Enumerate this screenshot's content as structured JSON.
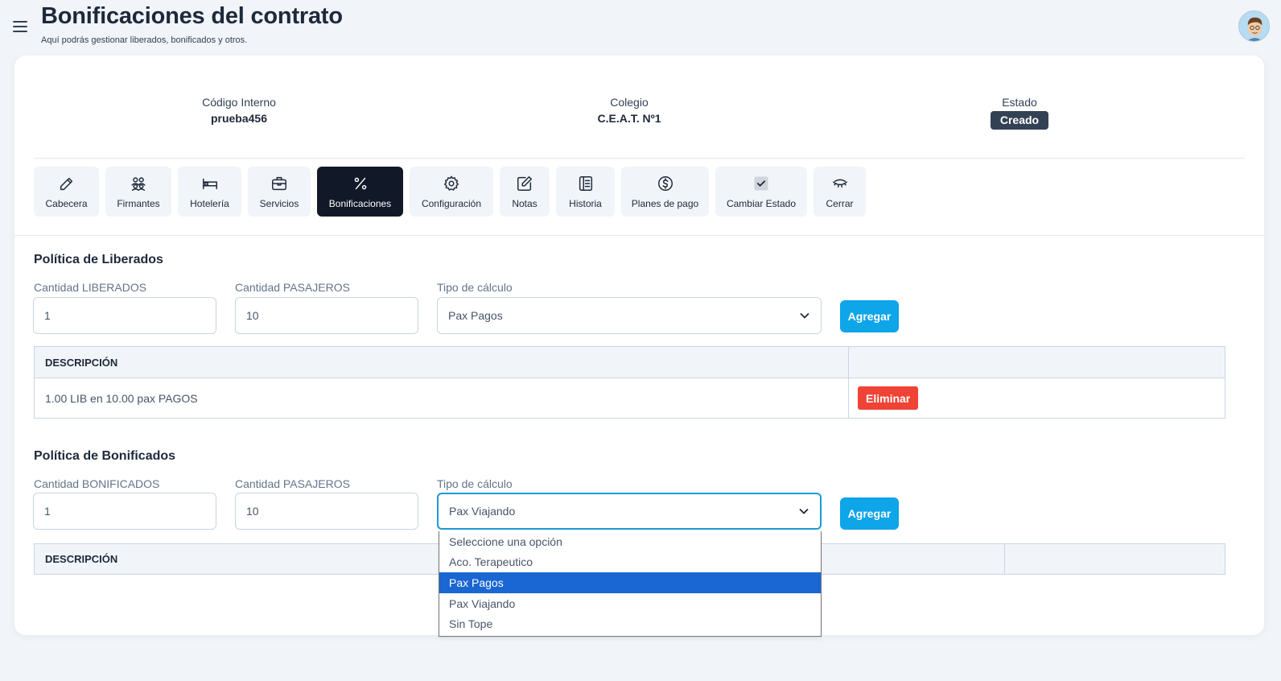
{
  "header": {
    "title": "Bonificaciones del contrato",
    "subtitle": "Aquí podrás gestionar liberados, bonificados y otros."
  },
  "info": {
    "codigo_label": "Código Interno",
    "codigo_value": "prueba456",
    "colegio_label": "Colegio",
    "colegio_value": "C.E.A.T. Nº1",
    "estado_label": "Estado",
    "estado_value": "Creado"
  },
  "tabs": [
    {
      "label": "Cabecera",
      "icon": "pencil-icon"
    },
    {
      "label": "Firmantes",
      "icon": "users-icon"
    },
    {
      "label": "Hotelería",
      "icon": "bed-icon"
    },
    {
      "label": "Servicios",
      "icon": "briefcase-icon"
    },
    {
      "label": "Bonificaciones",
      "icon": "percent-icon",
      "active": true
    },
    {
      "label": "Configuración",
      "icon": "gear-icon"
    },
    {
      "label": "Notas",
      "icon": "edit-note-icon"
    },
    {
      "label": "Historia",
      "icon": "document-list-icon"
    },
    {
      "label": "Planes de pago",
      "icon": "dollar-circle-icon"
    },
    {
      "label": "Cambiar Estado",
      "icon": "checkbox-icon"
    },
    {
      "label": "Cerrar",
      "icon": "closed-eye-icon"
    }
  ],
  "liberados": {
    "title": "Política de Liberados",
    "cantidad_label": "Cantidad LIBERADOS",
    "cantidad_value": "1",
    "pasajeros_label": "Cantidad PASAJEROS",
    "pasajeros_value": "10",
    "tipo_label": "Tipo de cálculo",
    "tipo_value": "Pax Pagos",
    "add_label": "Agregar",
    "table_header": "DESCRIPCIÓN",
    "rows": [
      {
        "descripcion": "1.00 LIB en 10.00 pax PAGOS",
        "action": "Eliminar"
      }
    ]
  },
  "bonificados": {
    "title": "Política de Bonificados",
    "cantidad_label": "Cantidad BONIFICADOS",
    "cantidad_value": "1",
    "pasajeros_label": "Cantidad PASAJEROS",
    "pasajeros_value": "10",
    "tipo_label": "Tipo de cálculo",
    "tipo_value": "Pax Viajando",
    "add_label": "Agregar",
    "table_header": "DESCRIPCIÓN"
  },
  "dropdown_options": [
    "Seleccione una opción",
    "Aco. Terapeutico",
    "Pax Pagos",
    "Pax Viajando",
    "Sin Tope"
  ],
  "dropdown_highlighted": "Pax Pagos",
  "colors": {
    "accent": "#0ea5e9",
    "danger": "#ef4336",
    "badge": "#334155",
    "active_tab": "#111827",
    "highlight": "#1a66d2"
  }
}
